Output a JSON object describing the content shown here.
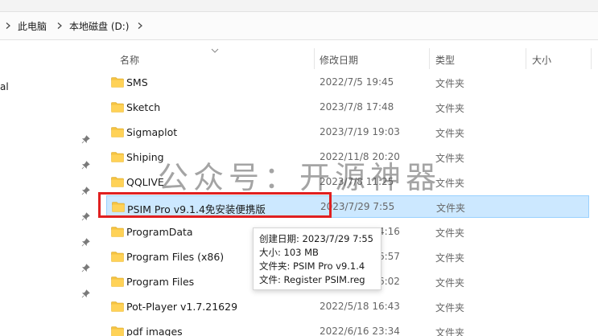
{
  "address_bar": {
    "crumbs": [
      "此电脑",
      "本地磁盘 (D:)"
    ]
  },
  "sidebar": {
    "fragment_text": "al"
  },
  "columns": {
    "name": "名称",
    "date": "修改日期",
    "type": "类型",
    "size": "大小"
  },
  "rows": [
    {
      "name": "SMS",
      "date": "2022/7/5 19:45",
      "type": "文件夹"
    },
    {
      "name": "Sketch",
      "date": "2023/7/8 17:48",
      "type": "文件夹"
    },
    {
      "name": "Sigmaplot",
      "date": "2023/7/19 19:03",
      "type": "文件夹"
    },
    {
      "name": "Shiping",
      "date": "2022/11/8 20:20",
      "type": "文件夹"
    },
    {
      "name": "QQLIVE",
      "date": "2023/7/8 11:25",
      "type": "文件夹"
    },
    {
      "name": "PSIM Pro v9.1.4免安装便携版",
      "date": "2023/7/29 7:55",
      "type": "文件夹"
    },
    {
      "name": "ProgramData",
      "date": "2023/7/29 14:16",
      "type": "文件夹"
    },
    {
      "name": "Program Files (x86)",
      "date": "2023/7/29 16:57",
      "type": "文件夹"
    },
    {
      "name": "Program Files",
      "date": "2023/7/29 16:02",
      "type": "文件夹"
    },
    {
      "name": "Pot-Player v1.7.21629",
      "date": "2022/5/18 16:43",
      "type": "文件夹"
    },
    {
      "name": "pdf images",
      "date": "2022/6/16 23:34",
      "type": "文件夹"
    }
  ],
  "tooltip": {
    "created": "创建日期: 2023/7/29 7:55",
    "size": "大小: 103 MB",
    "folders": "文件夹: PSIM Pro v9.1.4",
    "files": "文件: Register PSIM.reg"
  },
  "watermark": "公众号：开源神器",
  "colors": {
    "selected_bg": "#cce8ff",
    "selected_border": "#99d1ff",
    "highlight": "#e02020",
    "folder_yellow": "#f5c342"
  }
}
